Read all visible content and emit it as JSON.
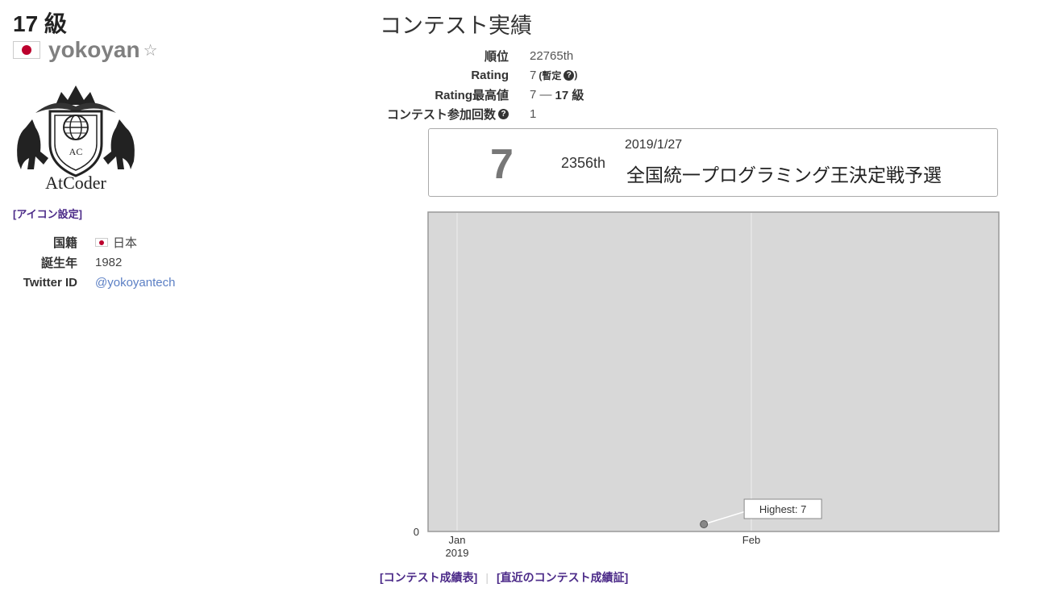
{
  "profile": {
    "kyu": "17 級",
    "username": "yokoyan",
    "logo_text": "AtCoder",
    "icon_setting_link": "[アイコン設定]",
    "info": [
      {
        "key": "国籍",
        "value": "日本",
        "flag": "japan-flag-icon"
      },
      {
        "key": "誕生年",
        "value": "1982"
      },
      {
        "key": "Twitter ID",
        "value": "@yokoyantech"
      }
    ]
  },
  "contest": {
    "title": "コンテスト実績",
    "stats": {
      "rank_label": "順位",
      "rank_value": "22765th",
      "rating_label": "Rating",
      "rating_value": "7",
      "rating_note": "(暫定",
      "rating_note_close": ")",
      "highest_label": "Rating最高値",
      "highest_value": "7 —",
      "highest_kyu": "17 級",
      "count_label": "コンテスト参加回数",
      "count_value": "1"
    },
    "latest": {
      "rating": "7",
      "place": "2356th",
      "date": "2019/1/27",
      "name": "全国統一プログラミング王決定戦予選"
    }
  },
  "chart_data": {
    "type": "line",
    "x_ticks": [
      "Jan 2019",
      "Feb"
    ],
    "y_ticks": [
      "0"
    ],
    "series": [
      {
        "values": [
          {
            "x": "2019-01-27",
            "y": 7
          }
        ]
      }
    ],
    "annotation": "Highest: 7",
    "background": "#d8d8d8"
  },
  "links": {
    "history": "[コンテスト成績表]",
    "latest_cert": "[直近のコンテスト成績証]"
  }
}
